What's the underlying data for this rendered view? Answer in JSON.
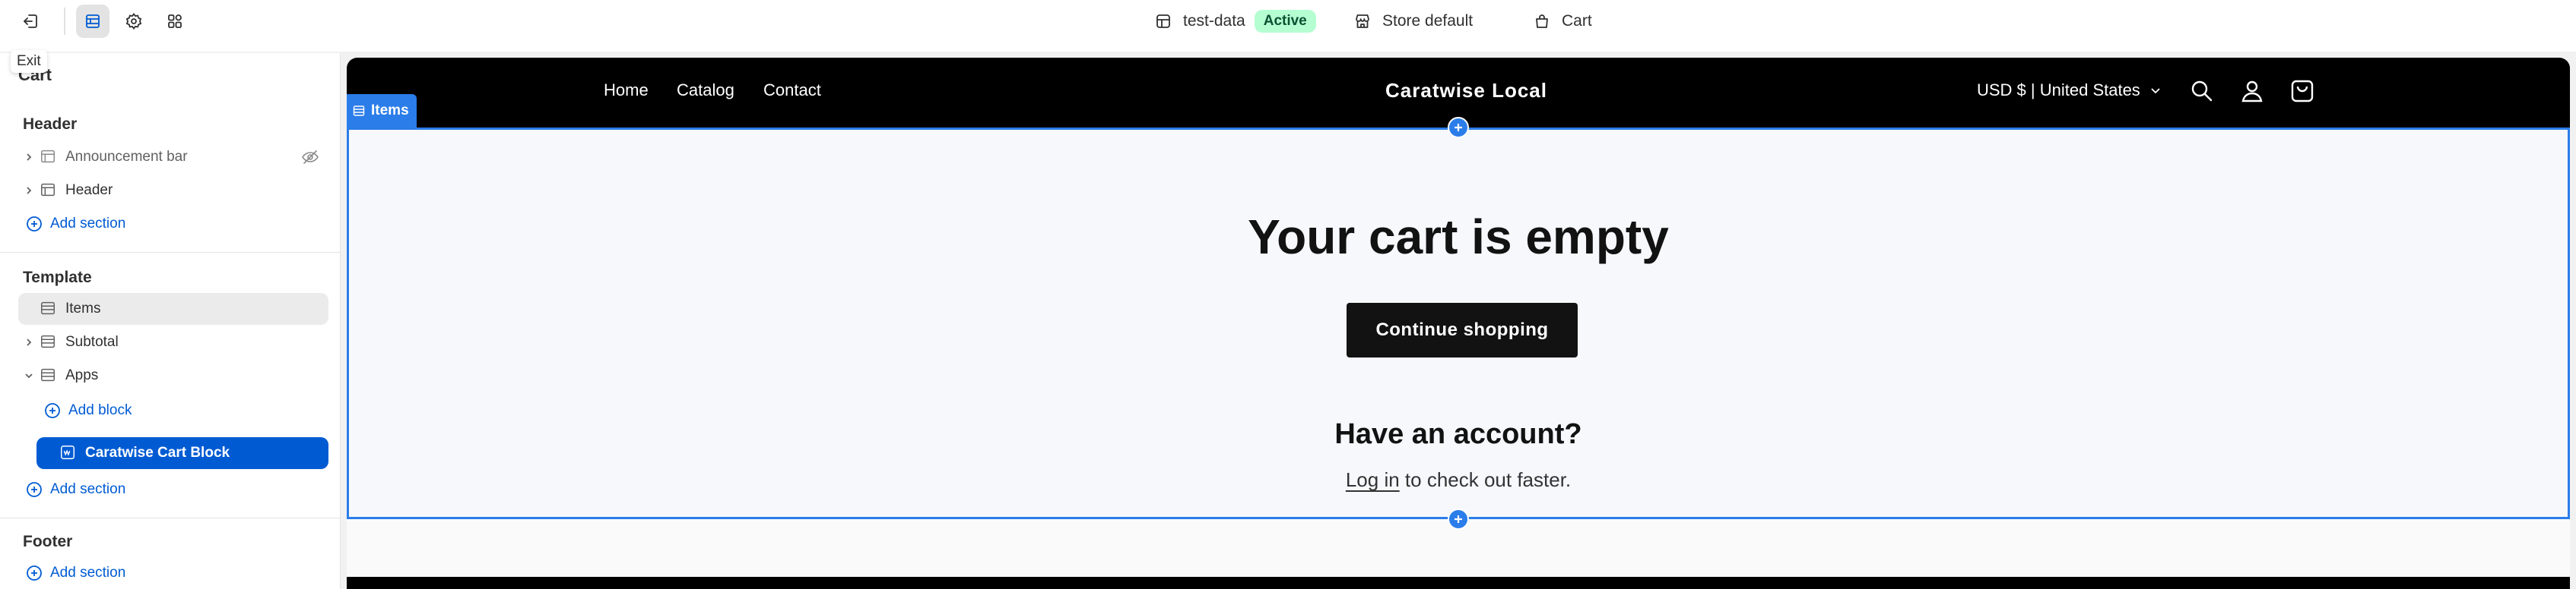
{
  "topbar": {
    "exit_tooltip": "Exit",
    "theme_name": "test-data",
    "theme_status": "Active",
    "store_label": "Store default",
    "page_label": "Cart"
  },
  "sidebar": {
    "title": "Cart",
    "header_group": "Header",
    "header_items": [
      "Announcement bar",
      "Header"
    ],
    "template_group": "Template",
    "template_items": [
      "Items",
      "Subtotal",
      "Apps"
    ],
    "add_block": "Add block",
    "app_block": "Caratwise Cart Block",
    "add_section": "Add section",
    "footer_group": "Footer"
  },
  "preview": {
    "nav": [
      "Home",
      "Catalog",
      "Contact"
    ],
    "logo": "Caratwise Local",
    "currency": "USD $ | United States",
    "section_tag": "Items",
    "cart_title": "Your cart is empty",
    "continue_label": "Continue shopping",
    "account_title": "Have an account?",
    "login_link": "Log in",
    "login_suffix": " to check out faster."
  },
  "colors": {
    "accent": "#005bd3",
    "selection_blue": "#2b7de9",
    "active_badge_bg": "#b4fed2",
    "store_header": "#000000"
  },
  "icons": [
    "exit-icon",
    "sections-icon",
    "gear-icon",
    "apps-icon",
    "theme-icon",
    "store-icon",
    "bag-icon",
    "search-icon",
    "account-icon",
    "cart-icon",
    "eye-off-icon",
    "plus-circle-icon"
  ]
}
